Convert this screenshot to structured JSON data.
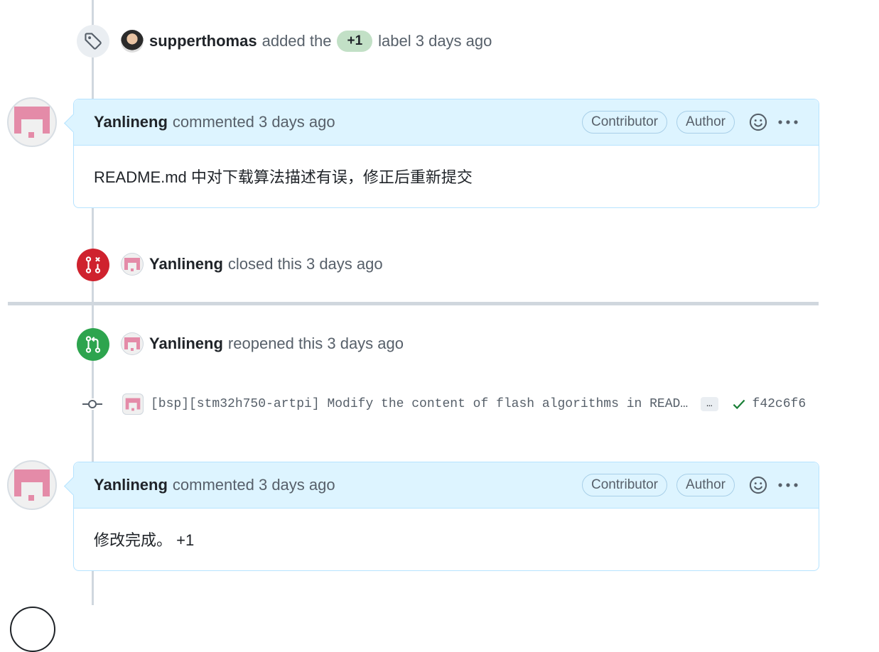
{
  "events": {
    "label_added": {
      "actor": "supperthomas",
      "pre_text": "added the",
      "label": "+1",
      "post_text": "label 3 days ago",
      "label_color": "#c2e0c6"
    },
    "closed": {
      "actor": "Yanlineng",
      "text": "closed this 3 days ago"
    },
    "reopened": {
      "actor": "Yanlineng",
      "text": "reopened this 3 days ago"
    }
  },
  "comments": [
    {
      "author": "Yanlineng",
      "meta": "commented 3 days ago",
      "badges": [
        "Contributor",
        "Author"
      ],
      "body": "README.md 中对下载算法描述有误，修正后重新提交"
    },
    {
      "author": "Yanlineng",
      "meta": "commented 3 days ago",
      "badges": [
        "Contributor",
        "Author"
      ],
      "body": "修改完成。 +1"
    }
  ],
  "commit": {
    "message": "[bsp][stm32h750-artpi] Modify the content of flash algorithms in READ…",
    "ellipsis": "…",
    "sha": "f42c6f6",
    "status": "check-success"
  },
  "icons": {
    "label": "tag-icon",
    "closed": "git-pull-request-closed-icon",
    "reopened": "git-pull-request-icon",
    "commit": "git-commit-icon",
    "reaction": "smiley-icon",
    "menu": "kebab-horizontal-icon",
    "check": "check-icon"
  },
  "colors": {
    "closed": "#cf222e",
    "reopened": "#2da44e",
    "comment_header": "#ddf4ff",
    "comment_border": "#b6e3ff"
  }
}
